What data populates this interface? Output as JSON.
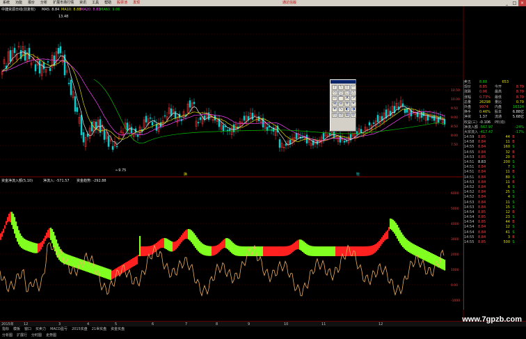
{
  "menu": {
    "items": [
      "系统",
      "功能",
      "报价",
      "分析",
      "扩展市场行情",
      "资讯",
      "工具",
      "帮助"
    ],
    "highlight_items": [
      "股票池",
      "发现"
    ],
    "right_label": "通达信版"
  },
  "main_chart": {
    "title": "中捷资源日线(前复权)",
    "ma_labels": [
      {
        "label": "MA5: 8.84",
        "color": "#e8e8e8"
      },
      {
        "label": "MA10: 8.88",
        "color": "#e0e000"
      },
      {
        "label": "MA20: 8.83",
        "color": "#ff40ff"
      },
      {
        "label": "MA60: 9.06",
        "color": "#00e000"
      }
    ],
    "high_label": "13.48",
    "low_label": "←9.75",
    "price_axis": [
      "10.50",
      "10.00",
      "9.50",
      "9.00",
      "8.50",
      "8.00",
      "7.50"
    ],
    "x_markers": [
      "换",
      "鞋"
    ]
  },
  "indicator": {
    "title": "资金净流入额(5,10)",
    "values": [
      {
        "label": "净流入: -571.57",
        "color": "#e8e8e8"
      },
      {
        "label": "资金趋势: -292.88",
        "color": "#e8e8e8"
      }
    ],
    "axis": [
      "6000",
      "5000",
      "4000",
      "3000",
      "2000",
      "1000",
      "0.00",
      "-1000"
    ]
  },
  "quote": {
    "top_row": {
      "label": "卖五",
      "value": "8.88",
      "vol": "653"
    },
    "rows": [
      {
        "l1": "现价",
        "v1": "8.85",
        "c1": "red",
        "l2": "今开",
        "v2": "8.79",
        "c2": "red"
      },
      {
        "l1": "涨跌",
        "v1": "0.06",
        "c1": "red",
        "l2": "最高",
        "v2": "8.79",
        "c2": "red"
      },
      {
        "l1": "涨幅",
        "v1": "0.73%",
        "c1": "red",
        "l2": "最低",
        "v2": "8.79",
        "c2": "red"
      },
      {
        "l1": "总量",
        "v1": "26298",
        "c1": "yellow",
        "l2": "量比",
        "v2": "0.79",
        "c2": "yellow"
      },
      {
        "l1": "外盘",
        "v1": "9974",
        "c1": "red",
        "l2": "内盘",
        "v2": "16324",
        "c2": "green"
      },
      {
        "l1": "换手",
        "v1": "0.46%",
        "c1": "yellow",
        "l2": "股本",
        "v2": "6.88亿",
        "c2": "white"
      },
      {
        "l1": "净资",
        "v1": "1.37",
        "c1": "white",
        "l2": "流通",
        "v2": "5.68亿",
        "c2": "white"
      },
      {
        "l1": "收益(三)",
        "v1": "-0.106",
        "c1": "white",
        "l2": "PE(动)",
        "v2": "",
        "c2": "white"
      },
      {
        "l1": "净流入额",
        "v1": "-567.97",
        "c1": "green",
        "l2": "",
        "v2": "-24%",
        "c2": "green"
      },
      {
        "l1": "大宗流入",
        "v1": "-417.47",
        "c1": "green",
        "l2": "",
        "v2": "-17%",
        "c2": "green"
      }
    ],
    "ticks": [
      {
        "t": "14:59",
        "p": "8.85",
        "v": "44",
        "bs": "B",
        "c": "red"
      },
      {
        "t": "14:58",
        "p": "8.84",
        "v": "11",
        "bs": "B",
        "c": "red"
      },
      {
        "t": "14:55",
        "p": "8.84",
        "v": "160",
        "bs": "S",
        "c": "red"
      },
      {
        "t": "14:55",
        "p": "8.84",
        "v": "32",
        "bs": "B",
        "c": "red"
      },
      {
        "t": "14:53",
        "p": "8.85",
        "v": "20",
        "bs": "B",
        "c": "red"
      },
      {
        "t": "14:51",
        "p": "8.83",
        "v": "200",
        "bs": "S",
        "c": "white"
      },
      {
        "t": "14:51",
        "p": "8.84",
        "v": "7",
        "bs": "S",
        "c": "red"
      },
      {
        "t": "14:51",
        "p": "8.84",
        "v": "11",
        "bs": "B",
        "c": "red"
      },
      {
        "t": "14:51",
        "p": "8.84",
        "v": "80",
        "bs": "S",
        "c": "red"
      },
      {
        "t": "14:53",
        "p": "8.84",
        "v": "11",
        "bs": "B",
        "c": "red"
      },
      {
        "t": "14:52",
        "p": "8.84",
        "v": "6",
        "bs": "S",
        "c": "red"
      },
      {
        "t": "14:52",
        "p": "8.84",
        "v": "25",
        "bs": "S",
        "c": "red"
      },
      {
        "t": "14:52",
        "p": "8.84",
        "v": "4",
        "bs": "S",
        "c": "red"
      },
      {
        "t": "14:53",
        "p": "8.84",
        "v": "11",
        "bs": "S",
        "c": "red"
      },
      {
        "t": "14:53",
        "p": "8.84",
        "v": "15",
        "bs": "S",
        "c": "red"
      },
      {
        "t": "14:54",
        "p": "8.85",
        "v": "12",
        "bs": "B",
        "c": "red"
      },
      {
        "t": "14:54",
        "p": "8.85",
        "v": "23",
        "bs": "S",
        "c": "red"
      },
      {
        "t": "14:54",
        "p": "8.85",
        "v": "44",
        "bs": "B",
        "c": "red"
      },
      {
        "t": "14:54",
        "p": "8.84",
        "v": "12",
        "bs": "S",
        "c": "red"
      },
      {
        "t": "14:54",
        "p": "8.84",
        "v": "41",
        "bs": "S",
        "c": "red"
      },
      {
        "t": "14:55",
        "p": "8.84",
        "v": "3",
        "bs": "B",
        "c": "red"
      },
      {
        "t": "14:55",
        "p": "8.85",
        "v": "500",
        "bs": "S",
        "c": "red"
      }
    ]
  },
  "date_axis": [
    "2015年",
    "12",
    "3",
    "4",
    "5",
    "6",
    "7",
    "8",
    "9",
    "10",
    "11",
    "12"
  ],
  "tabs_row1": [
    "指标",
    "模板",
    "窗口",
    "买卖力",
    "MACD盈亏",
    "2015实盘",
    "21世实盘",
    "资金实盘"
  ],
  "tabs_row2": [
    "分析图",
    "扩展行",
    "分时图",
    "走势图"
  ],
  "watermark": "www.7gpzb.com"
}
